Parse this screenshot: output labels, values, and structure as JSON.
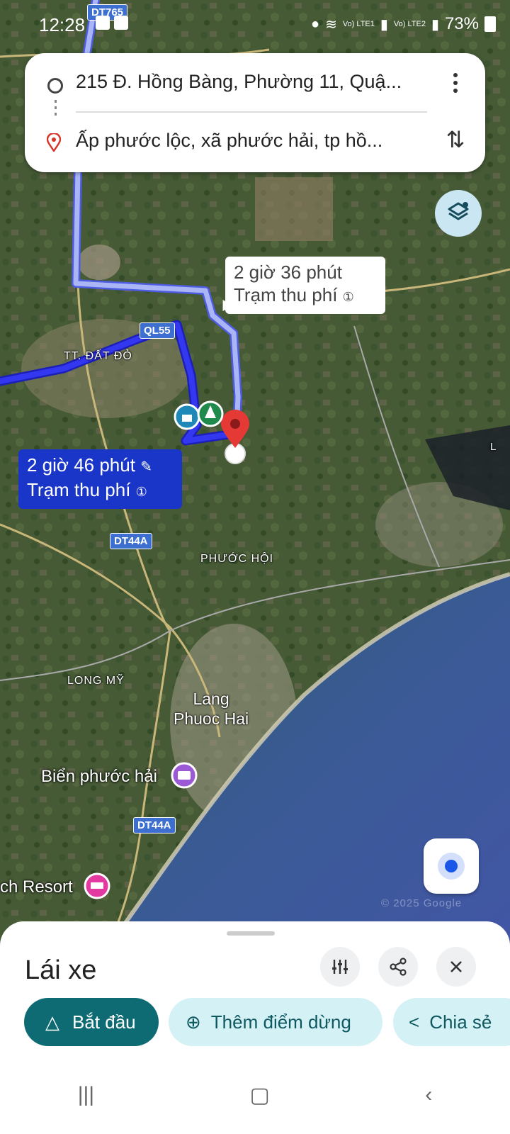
{
  "status": {
    "time": "12:28",
    "battery": "73%",
    "signal_labels": [
      "Vo) LTE1",
      "Vo) LTE2"
    ]
  },
  "route": {
    "origin": "215 Đ. Hồng Bàng, Phường 11, Quậ...",
    "destination": "Ấp phước lộc, xã phước hải, tp hồ..."
  },
  "map": {
    "callouts": {
      "alternate": {
        "duration": "2 giờ 36 phút",
        "note": "Trạm thu phí"
      },
      "selected": {
        "duration": "2 giờ 46 phút",
        "note": "Trạm thu phí"
      }
    },
    "road_shields": [
      "DT765",
      "QL55",
      "DT44A",
      "DT44A"
    ],
    "place_labels": [
      "TT. ĐẤT ĐỎ",
      "PHƯỚC HỘI",
      "LONG MỸ"
    ],
    "town_label": {
      "line1": "Lang",
      "line2": "Phuoc Hai"
    },
    "pois": [
      "Biển phước hải",
      "ch Resort"
    ],
    "edge_label": "L",
    "watermark": "© 2025 Google"
  },
  "sheet": {
    "title": "Lái xe",
    "actions": {
      "start": "Bắt đầu",
      "add_stop": "Thêm điểm dừng",
      "share": "Chia sẻ"
    }
  },
  "colors": {
    "route_selected": "#2b2ee6",
    "route_alternate": "#9ba8f2",
    "start_button": "#0e6b74",
    "chip_bg": "#d4f1f6",
    "sea": "#3f5aa0"
  }
}
